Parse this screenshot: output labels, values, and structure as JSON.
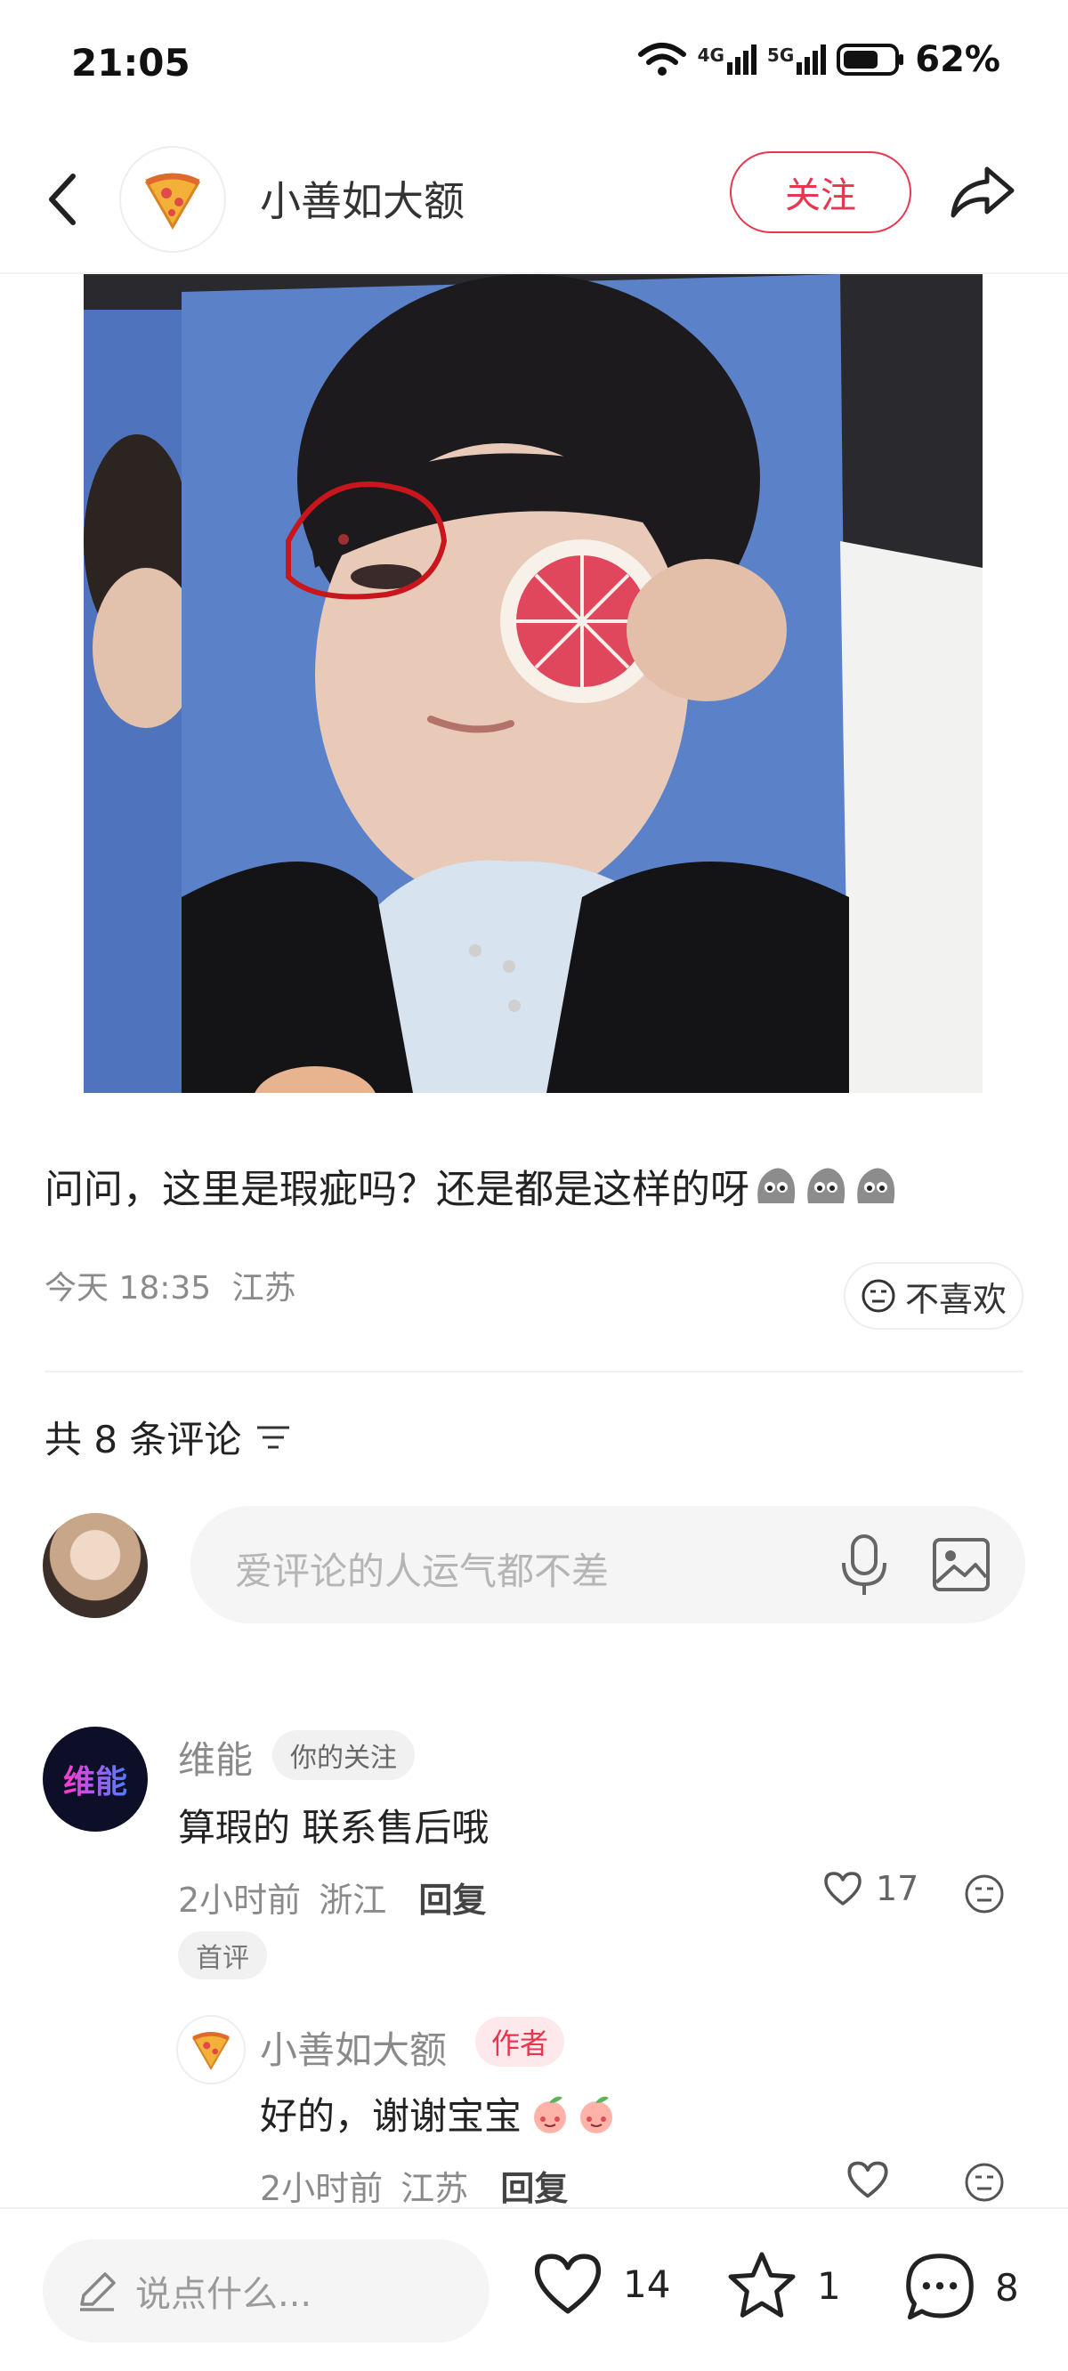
{
  "status_bar": {
    "time": "21:05",
    "net1": "4G",
    "net2": "5G",
    "battery": "62%"
  },
  "header": {
    "author": "小善如大额",
    "follow_label": "关注"
  },
  "post": {
    "text": "问问，这里是瑕疵吗？还是都是这样的呀",
    "date": "今天 18:35",
    "location": "江苏",
    "dislike_label": "不喜欢"
  },
  "comments_header": {
    "label": "共 8 条评论"
  },
  "comment_input": {
    "placeholder": "爱评论的人运气都不差"
  },
  "comments": [
    {
      "avatar_text": "维能",
      "name": "维能",
      "tag": "你的关注",
      "text": "算瑕的 联系售后哦",
      "time": "2小时前",
      "location": "浙江",
      "reply_label": "回复",
      "likes": "17",
      "badge": "首评"
    },
    {
      "name": "小善如大额",
      "tag": "作者",
      "text": "好的，谢谢宝宝",
      "time": "2小时前",
      "location": "江苏",
      "reply_label": "回复"
    }
  ],
  "bottom_bar": {
    "say_placeholder": "说点什么...",
    "likes": "14",
    "stars": "1",
    "comments": "8"
  },
  "colors": {
    "accent": "#e8364f",
    "photo_bg": "#5b82c9"
  }
}
